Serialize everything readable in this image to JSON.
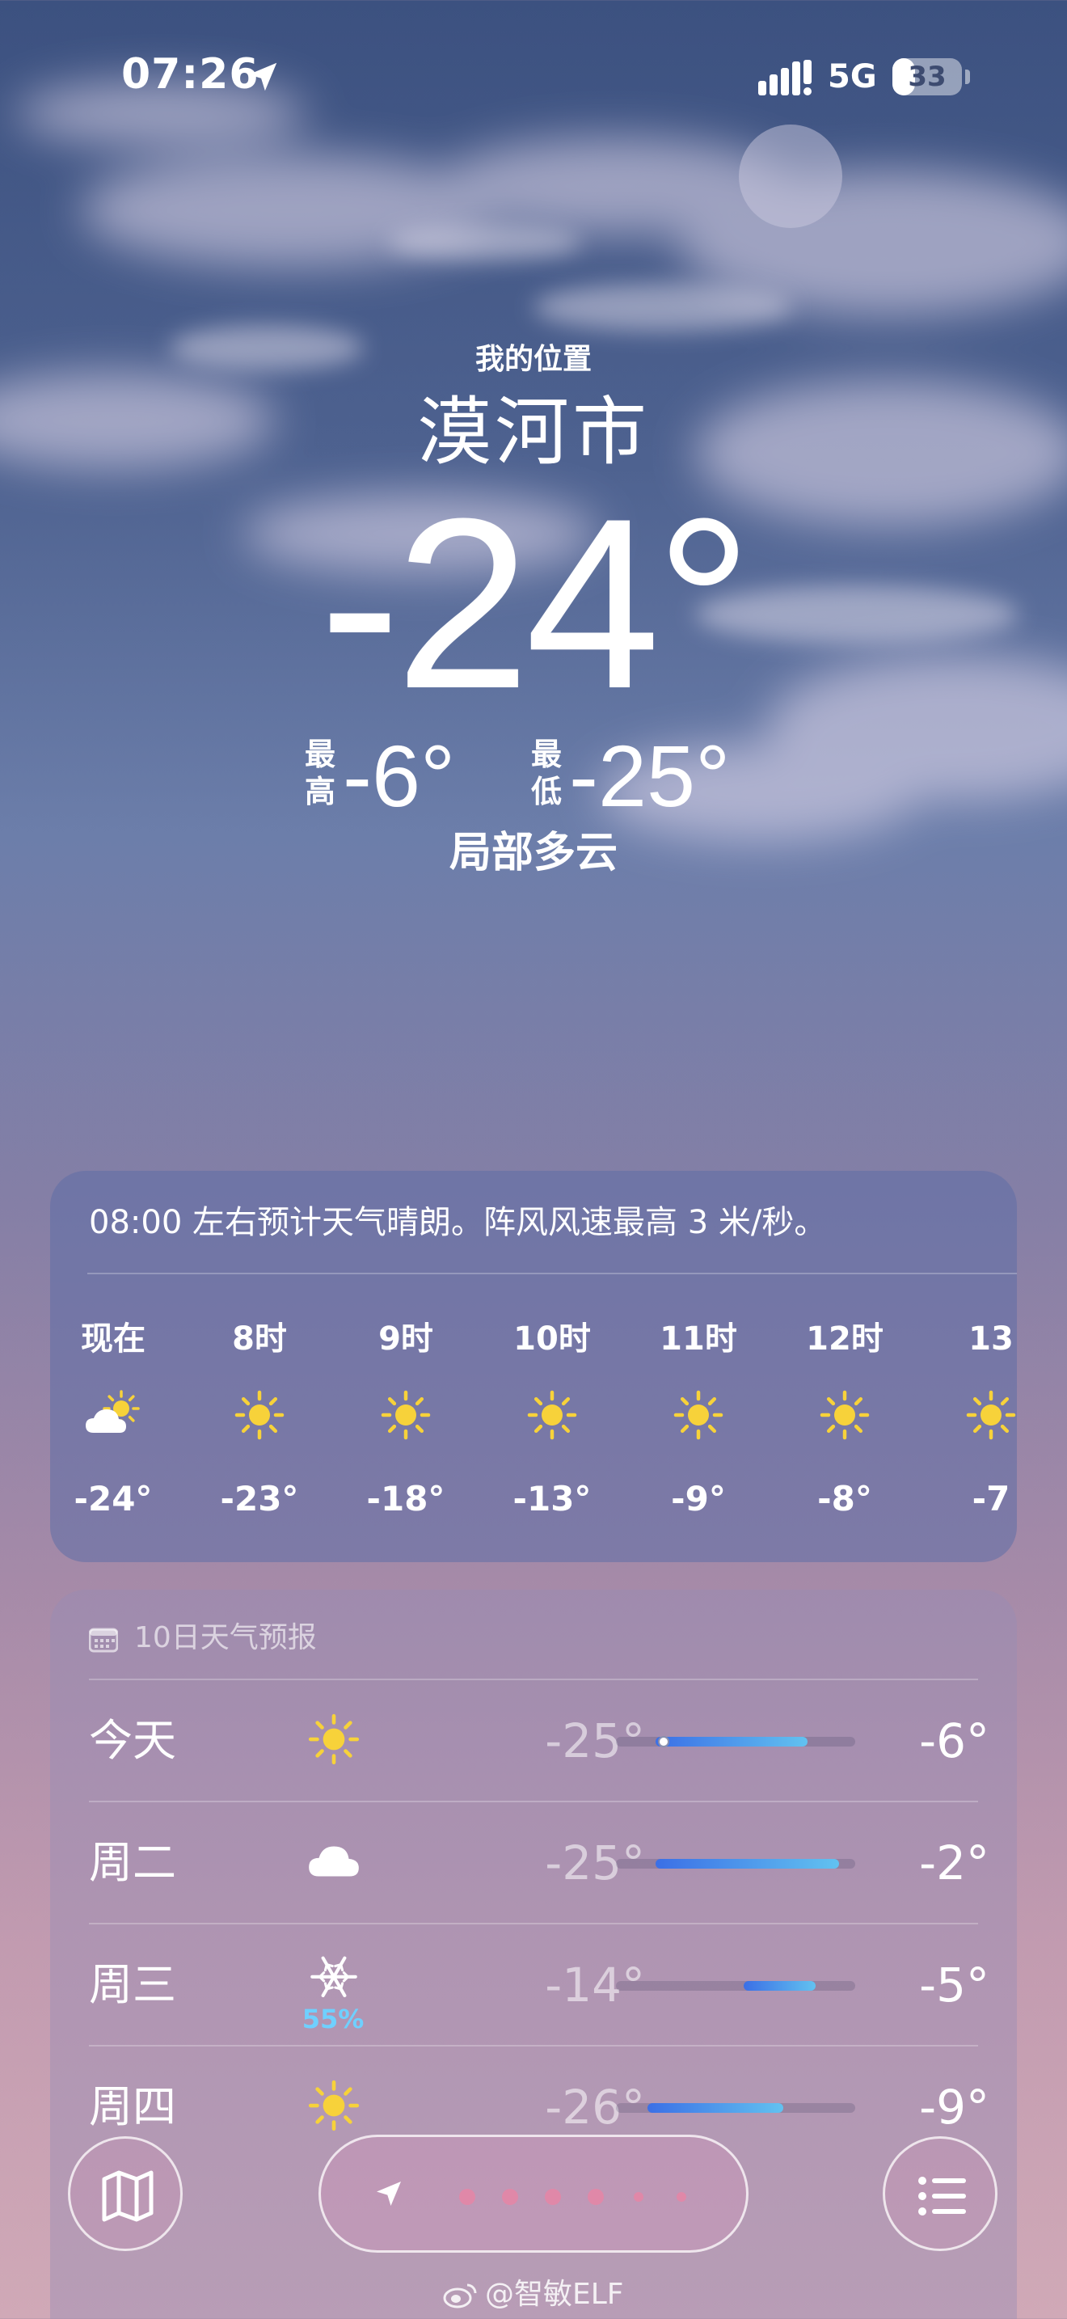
{
  "status_bar": {
    "time": "07:26",
    "network": "5G",
    "battery": "33",
    "battery_level": 0.33,
    "icons": [
      "location-arrow-icon",
      "signal-icon",
      "battery-icon"
    ]
  },
  "location": {
    "label": "我的位置",
    "city": "漠河市",
    "temperature": "-24°",
    "high_tag": "最高",
    "high": "-6°",
    "low_tag": "最低",
    "low": "-25°",
    "condition": "局部多云"
  },
  "hourly": {
    "summary": "08:00 左右预计天气晴朗。阵风风速最高 3 米/秒。",
    "hours": [
      {
        "label": "现在",
        "icon": "partly-cloudy-icon",
        "temp": "-24°"
      },
      {
        "label": "8时",
        "icon": "sun-icon",
        "temp": "-23°"
      },
      {
        "label": "9时",
        "icon": "sun-icon",
        "temp": "-18°"
      },
      {
        "label": "10时",
        "icon": "sun-icon",
        "temp": "-13°"
      },
      {
        "label": "11时",
        "icon": "sun-icon",
        "temp": "-9°"
      },
      {
        "label": "12时",
        "icon": "sun-icon",
        "temp": "-8°"
      },
      {
        "label": "13",
        "icon": "sun-icon",
        "temp": "-7"
      }
    ]
  },
  "forecast": {
    "title": "10日天气预报",
    "days": [
      {
        "day": "今天",
        "icon": "sun-icon",
        "precip": "",
        "low": "-25°",
        "high": "-6°",
        "low_c": -25,
        "high_c": -6,
        "current_c": -24
      },
      {
        "day": "周二",
        "icon": "cloud-icon",
        "precip": "",
        "low": "-25°",
        "high": "-2°",
        "low_c": -25,
        "high_c": -2
      },
      {
        "day": "周三",
        "icon": "snowflake-icon",
        "precip": "55%",
        "low": "-14°",
        "high": "-5°",
        "low_c": -14,
        "high_c": -5
      },
      {
        "day": "周四",
        "icon": "sun-icon",
        "precip": "",
        "low": "-26°",
        "high": "-9°",
        "low_c": -26,
        "high_c": -9
      }
    ],
    "range_c": [
      -30,
      0
    ]
  },
  "toolbar": {
    "map_icon": "map-icon",
    "list_icon": "list-icon",
    "pages": 7,
    "current_page": 0
  },
  "watermark": "@智敏ELF",
  "colors": {
    "bar_start": "#3b6fe6",
    "bar_end": "#62c2f0",
    "sun": "#f7d23a",
    "precip": "#6fd0ff",
    "page_dot": "#e088a8"
  }
}
